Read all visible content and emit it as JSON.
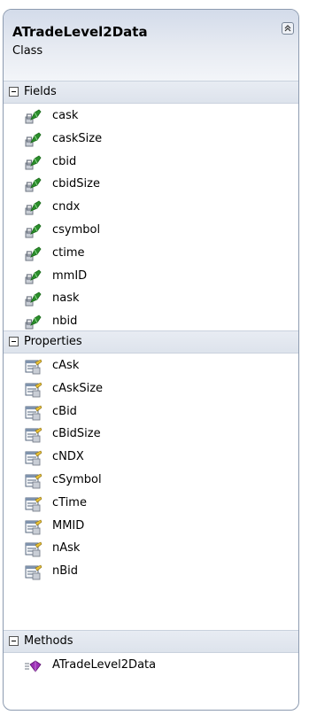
{
  "class_box": {
    "title": "ATradeLevel2Data",
    "kind": "Class"
  },
  "fields": {
    "label": "Fields",
    "items": [
      "cask",
      "caskSize",
      "cbid",
      "cbidSize",
      "cndx",
      "csymbol",
      "ctime",
      "mmID",
      "nask",
      "nbid"
    ]
  },
  "properties": {
    "label": "Properties",
    "items": [
      "cAsk",
      "cAskSize",
      "cBid",
      "cBidSize",
      "cNDX",
      "cSymbol",
      "cTime",
      "MMID",
      "nAsk",
      "nBid"
    ]
  },
  "methods": {
    "label": "Methods",
    "items": [
      "ATradeLevel2Data"
    ]
  },
  "icons": {
    "field": "field-icon",
    "property": "property-icon",
    "method": "method-icon",
    "collapse": "chevron-up-icon",
    "section_toggle": "minus-box-icon"
  },
  "colors": {
    "border": "#8d9bb0",
    "header_gradient": "#d3dbea",
    "section_band": "#dde3ec",
    "field_icon": "#2b8f2b",
    "method_icon": "#9b2fb5"
  }
}
